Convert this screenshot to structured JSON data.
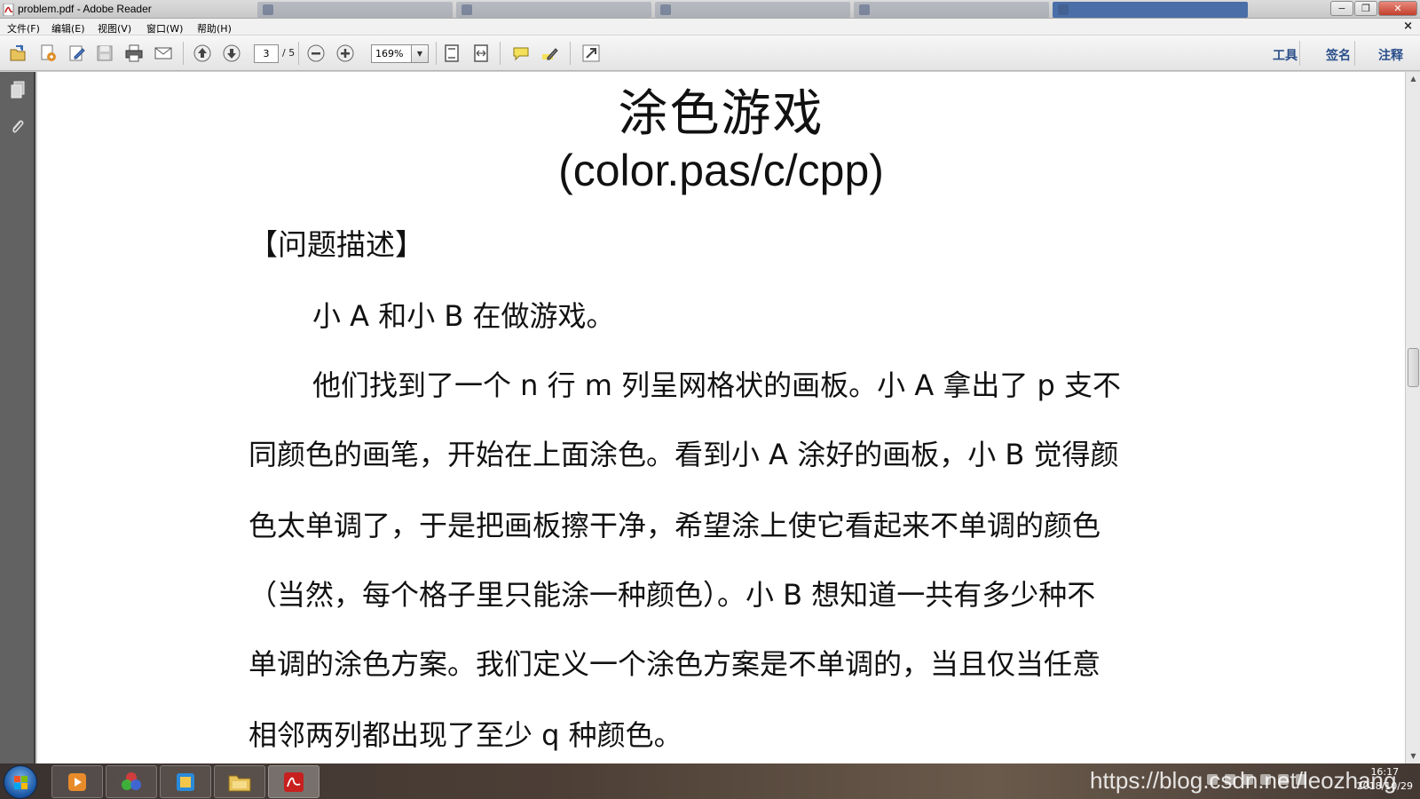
{
  "window": {
    "title": "problem.pdf - Adobe Reader",
    "minimize_glyph": "−",
    "restore_glyph": "❐",
    "close_glyph": "✕",
    "doc_close_glyph": "×"
  },
  "menu": {
    "file": "文件(F)",
    "edit": "编辑(E)",
    "view": "视图(V)",
    "window": "窗口(W)",
    "help": "帮助(H)"
  },
  "toolbar": {
    "current_page": "3",
    "total_pages": "/ 5",
    "zoom": "169%",
    "zoom_dropdown_glyph": "▼",
    "tools_label": "工具",
    "sign_label": "签名",
    "comment_label": "注释"
  },
  "document": {
    "title": "涂色游戏",
    "subtitle": "(color.pas/c/cpp)",
    "section_heading": "【问题描述】",
    "lines": [
      "小 A 和小 B 在做游戏。",
      "他们找到了一个 n 行 m 列呈网格状的画板。小 A 拿出了 p 支不",
      "同颜色的画笔，开始在上面涂色。看到小 A 涂好的画板，小 B 觉得颜",
      "色太单调了，于是把画板擦干净，希望涂上使它看起来不单调的颜色",
      "（当然，每个格子里只能涂一种颜色）。小 B 想知道一共有多少种不",
      "单调的涂色方案。我们定义一个涂色方案是不单调的，当且仅当任意",
      "相邻两列都出现了至少 q 种颜色。"
    ]
  },
  "scrollbar": {
    "up_glyph": "▲",
    "down_glyph": "▼",
    "position": 0.42
  },
  "taskbar": {
    "watermark": "https://blog.csdn.net/leozhang",
    "time": "16:17",
    "date": "2018/10/29"
  },
  "colors": {
    "accent": "#2a4f8a",
    "pdf_red": "#c8201f"
  }
}
